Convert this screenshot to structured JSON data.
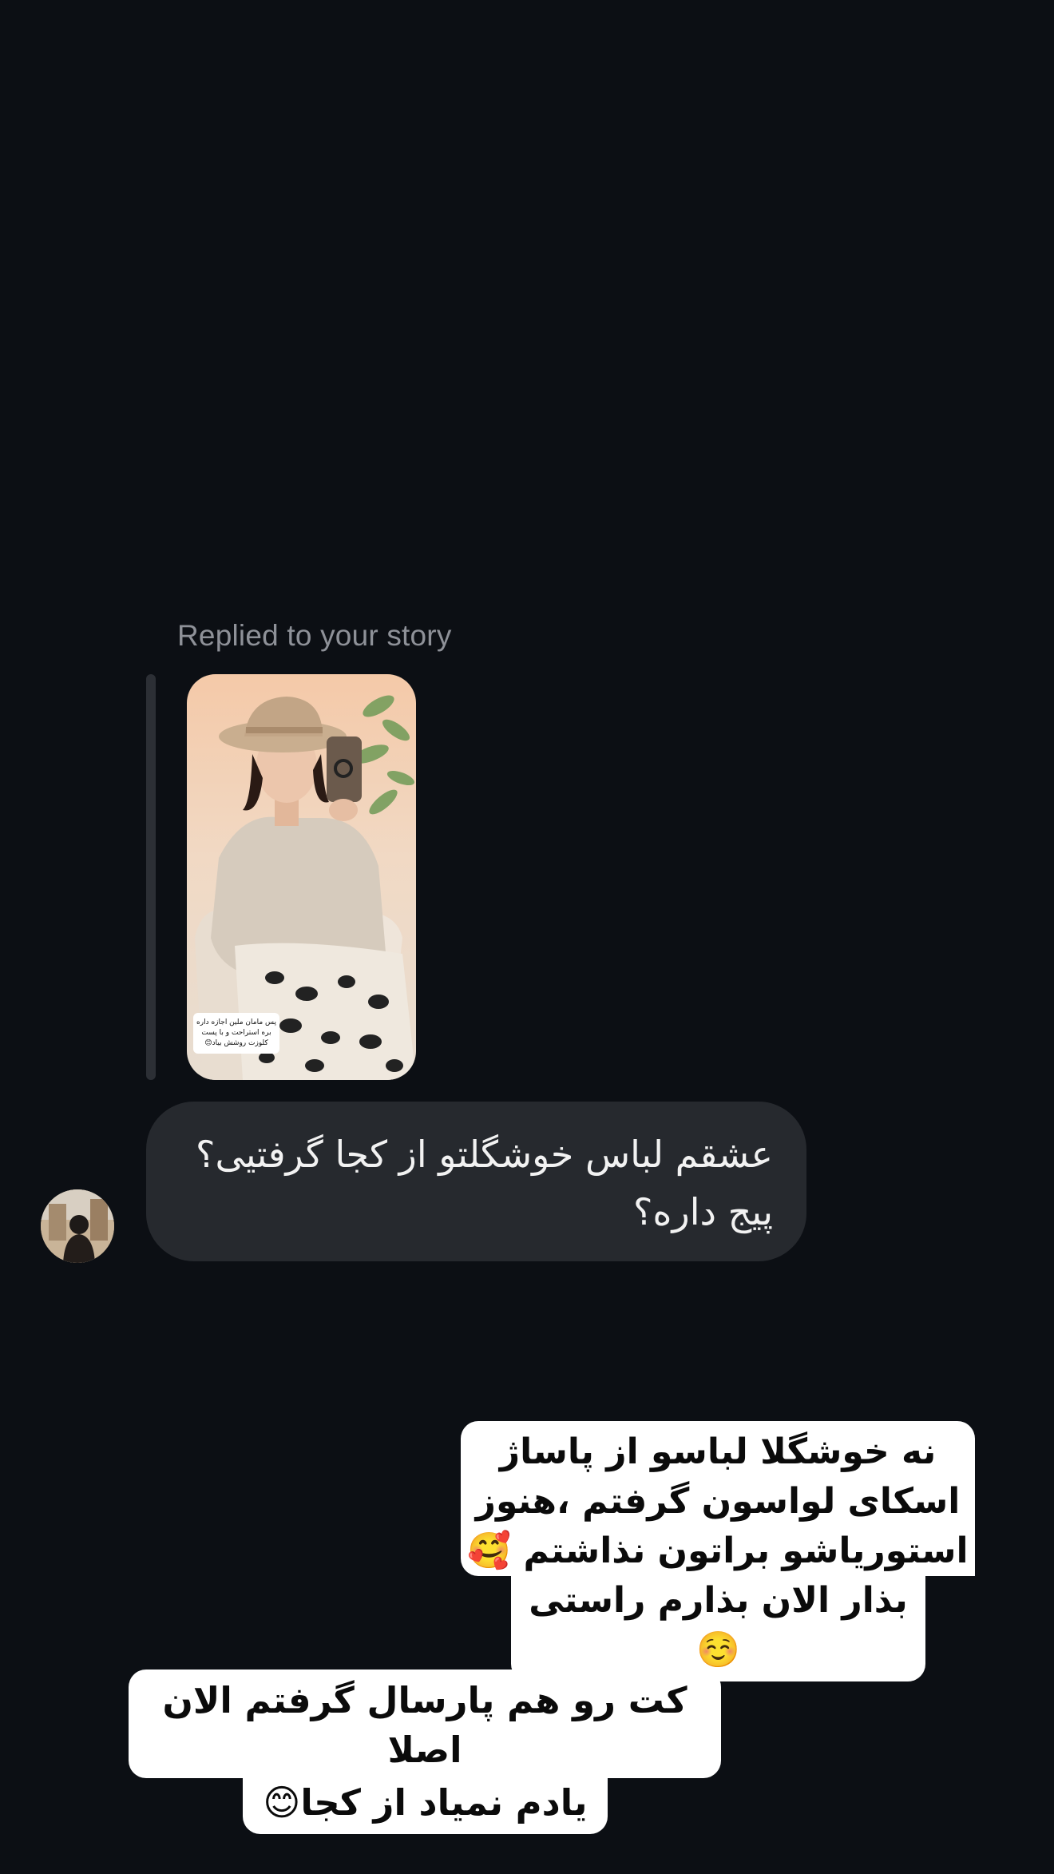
{
  "thread": {
    "reply_context_label": "Replied to your story",
    "story": {
      "sticker_text": "پس مامان ملین اجازه داره بره استراحت و با پست کلوزت روشش بیاد😊"
    },
    "incoming_message": {
      "lines": [
        "عشقم لباس خوشگلتو از کجا گرفتیی؟",
        "پیج داره؟"
      ]
    },
    "reply_sticker_1": {
      "lines": [
        "نه خوشگلا لباسو از پاساژ",
        "اسکای لواسون گرفتم ،هنوز",
        "استوریاشو براتون نذاشتم 🥰",
        "بذار الان بذارم راستی☺️"
      ]
    },
    "reply_sticker_2": {
      "lines": [
        "کت رو هم پارسال گرفتم الان اصلا",
        "یادم نمیاد از کجا😊"
      ]
    }
  },
  "colors": {
    "background": "#0c0f14",
    "incoming_bubble": "#26292e",
    "muted_text": "#8e9198",
    "sticker_bg": "#ffffff"
  }
}
